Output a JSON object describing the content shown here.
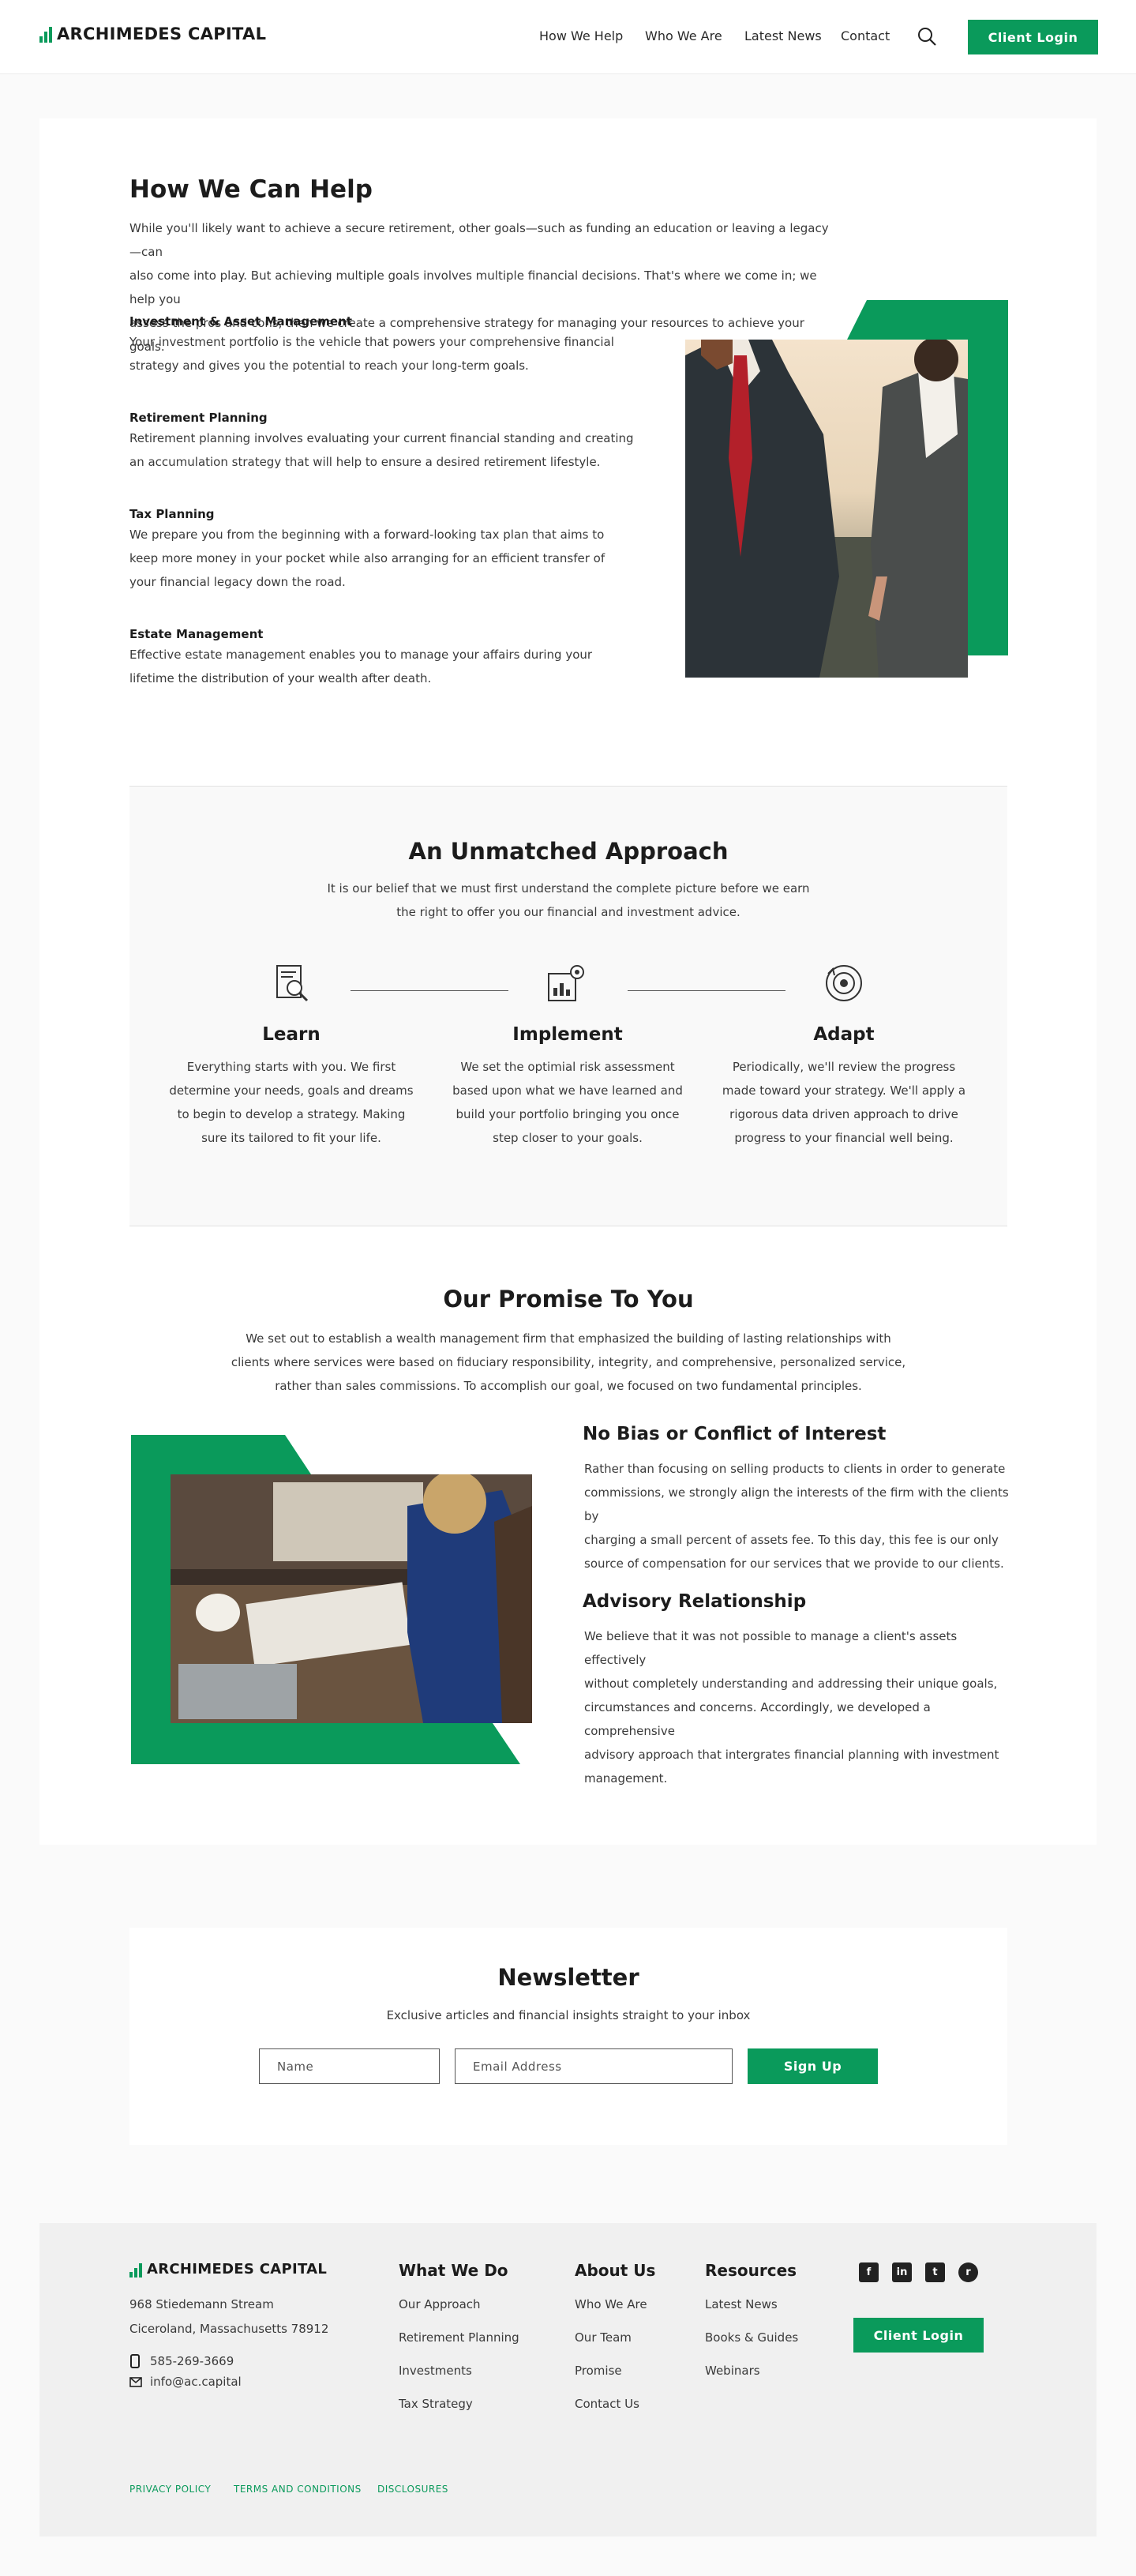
{
  "header": {
    "brand": "ARCHIMEDES CAPITAL",
    "nav": [
      "How We Help",
      "Who We Are",
      "Latest News",
      "Contact"
    ],
    "client_login": "Client Login"
  },
  "help": {
    "title": "How We Can Help",
    "intro": [
      "While you'll likely want to achieve a secure retirement, other goals—such as funding an education or leaving a legacy—can",
      "also come into play. But achieving multiple goals involves multiple financial decisions. That's where we come in; we help you",
      "assess the pros and cons, then we create a comprehensive strategy for managing your resources to achieve your goals."
    ],
    "services": [
      {
        "title": "Investment & Asset Management",
        "lines": [
          "Your investment portfolio is the vehicle that powers your comprehensive financial",
          "strategy and gives you the potential to reach your long-term goals."
        ]
      },
      {
        "title": "Retirement Planning",
        "lines": [
          "Retirement planning involves evaluating your current financial standing and creating",
          "an accumulation strategy that will help to ensure a desired retirement lifestyle."
        ]
      },
      {
        "title": "Tax Planning",
        "lines": [
          "We prepare you from the beginning with a forward-looking tax plan that aims to",
          "keep more money in your pocket while also arranging for an efficient transfer of",
          "your financial legacy down the road."
        ]
      },
      {
        "title": "Estate Management",
        "lines": [
          "Effective estate management enables you to manage your affairs during your",
          "lifetime the distribution of your wealth after death."
        ]
      }
    ]
  },
  "approach": {
    "title": "An Unmatched Approach",
    "intro": [
      "It is our belief that we must first understand the complete picture before we earn",
      "the right to offer you our financial and investment advice."
    ],
    "steps": [
      {
        "title": "Learn",
        "icon": "magnifier-document-icon",
        "lines": [
          "Everything starts with you. We first",
          "determine your needs, goals and dreams",
          "to begin to develop a strategy. Making",
          "sure its tailored to fit your life."
        ]
      },
      {
        "title": "Implement",
        "icon": "gear-chart-icon",
        "lines": [
          "We set the optimial risk assessment",
          "based upon what we have learned and",
          "build your portfolio bringing you once",
          "step closer to your goals."
        ]
      },
      {
        "title": "Adapt",
        "icon": "target-cycle-icon",
        "lines": [
          "Periodically, we'll review the progress",
          "made toward your strategy. We'll apply a",
          "rigorous data driven approach to drive",
          "progress to your financial well being."
        ]
      }
    ]
  },
  "promise": {
    "title": "Our Promise To You",
    "intro": [
      "We set out to establish a wealth management firm that emphasized the building of lasting relationships with",
      "clients where services were based on fiduciary responsibility, integrity, and comprehensive, personalized service,",
      "rather than sales commissions. To accomplish our goal, we focused on two fundamental principles."
    ],
    "points": [
      {
        "title": "No Bias or Conflict of Interest",
        "lines": [
          "Rather than focusing on selling products to clients in order to generate",
          "commissions, we strongly align the interests of the firm with the clients by",
          "charging a small percent of assets fee. To this day, this fee is our only",
          "source of compensation for our services that we provide to our clients."
        ]
      },
      {
        "title": "Advisory Relationship",
        "lines": [
          "We believe that it was not possible to manage a client's assets effectively",
          "without completely understanding and addressing their unique goals,",
          "circumstances and concerns. Accordingly, we developed a comprehensive",
          "advisory approach that intergrates financial planning with investment",
          "management."
        ]
      }
    ]
  },
  "newsletter": {
    "title": "Newsletter",
    "subtitle": "Exclusive articles and financial insights straight to your inbox",
    "name_placeholder": "Name",
    "email_placeholder": "Email Address",
    "signup": "Sign Up"
  },
  "footer": {
    "brand": "ARCHIMEDES CAPITAL",
    "address1": "968 Stiedemann Stream",
    "address2": "Ciceroland, Massachusetts 78912",
    "phone": "585-269-3669",
    "email": "info@ac.capital",
    "cols": [
      {
        "title": "What We Do",
        "items": [
          "Our Approach",
          "Retirement Planning",
          "Investments",
          "Tax Strategy"
        ]
      },
      {
        "title": "About Us",
        "items": [
          "Who We Are",
          "Our Team",
          "Promise",
          "Contact Us"
        ]
      },
      {
        "title": "Resources",
        "items": [
          "Latest News",
          "Books & Guides",
          "Webinars"
        ]
      }
    ],
    "social": [
      "facebook-icon",
      "linkedin-icon",
      "twitter-icon",
      "reddit-icon"
    ],
    "client_login": "Client Login",
    "legal": [
      "PRIVACY POLICY",
      "TERMS AND CONDITIONS",
      "DISCLOSURES"
    ]
  },
  "colors": {
    "accent": "#0a9a5b",
    "text": "#2a2a2a"
  }
}
